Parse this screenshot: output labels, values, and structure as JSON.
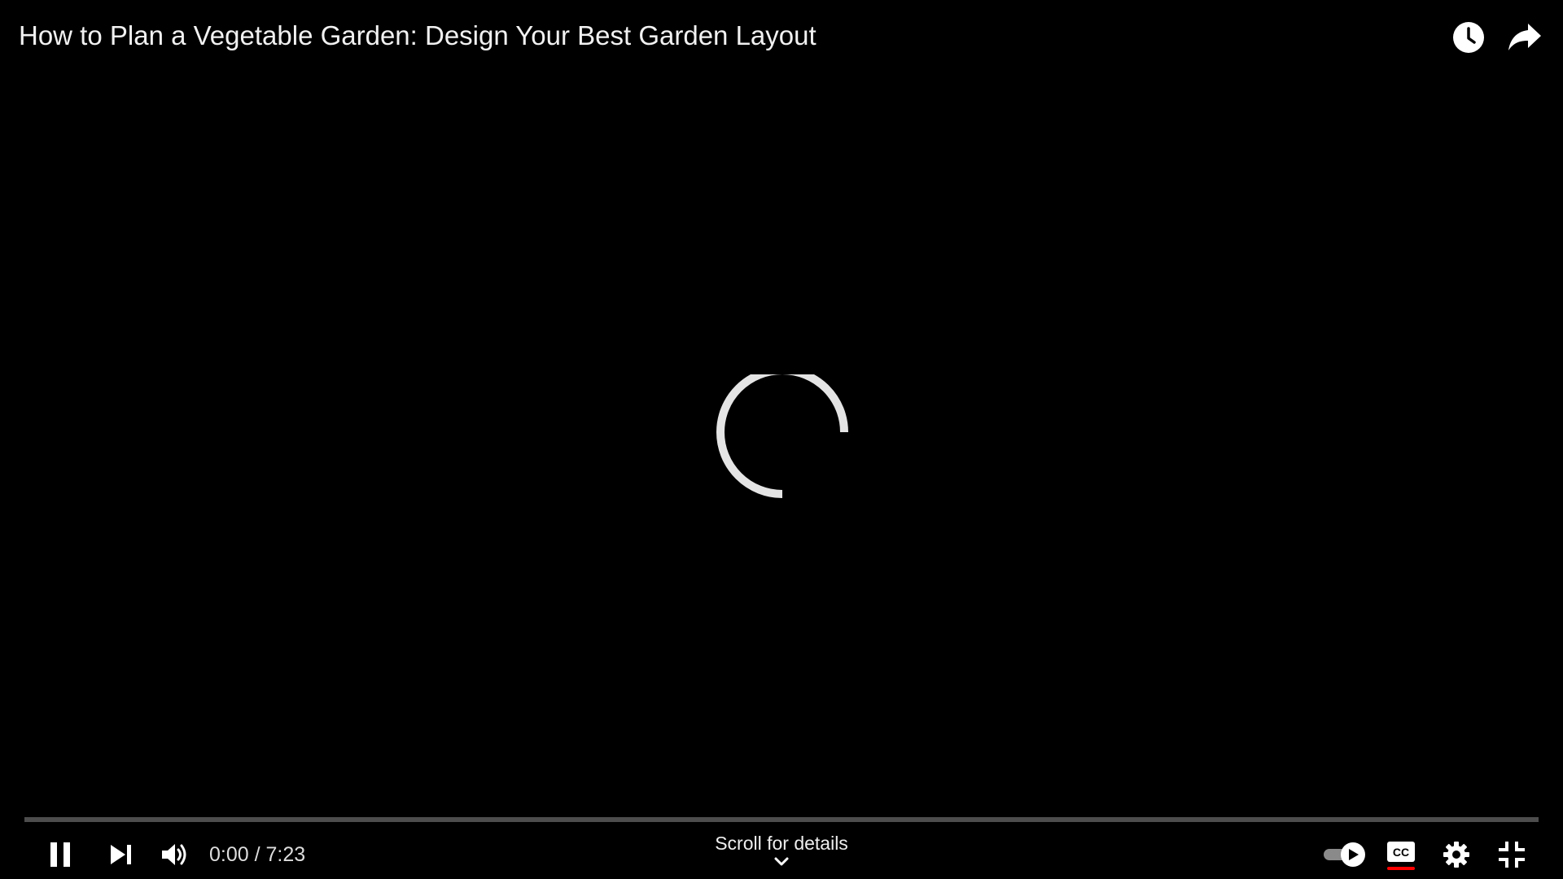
{
  "player": {
    "title": "How to Plan a Vegetable Garden: Design Your Best Garden Layout",
    "state": "loading",
    "top_actions": [
      {
        "name": "watch-later",
        "icon": "clock-icon"
      },
      {
        "name": "share",
        "icon": "share-arrow-icon"
      }
    ]
  },
  "controls": {
    "play_state": "paused-icon-shown",
    "current_time": "0:00",
    "duration": "7:23",
    "time_text": "0:00 / 7:23",
    "scroll_hint": "Scroll for details",
    "progress_fraction": 0,
    "autoplay_on": true,
    "captions_on": true,
    "icons": {
      "pause": "pause-icon",
      "next": "skip-next-icon",
      "volume": "volume-icon",
      "autoplay": "autoplay-toggle-icon",
      "captions": "cc-icon",
      "settings": "gear-icon",
      "fullscreen": "exit-fullscreen-icon",
      "scroll": "chevron-down-icon"
    }
  },
  "colors": {
    "background": "#000000",
    "accent": "#ff0000",
    "text": "#ffffff"
  }
}
